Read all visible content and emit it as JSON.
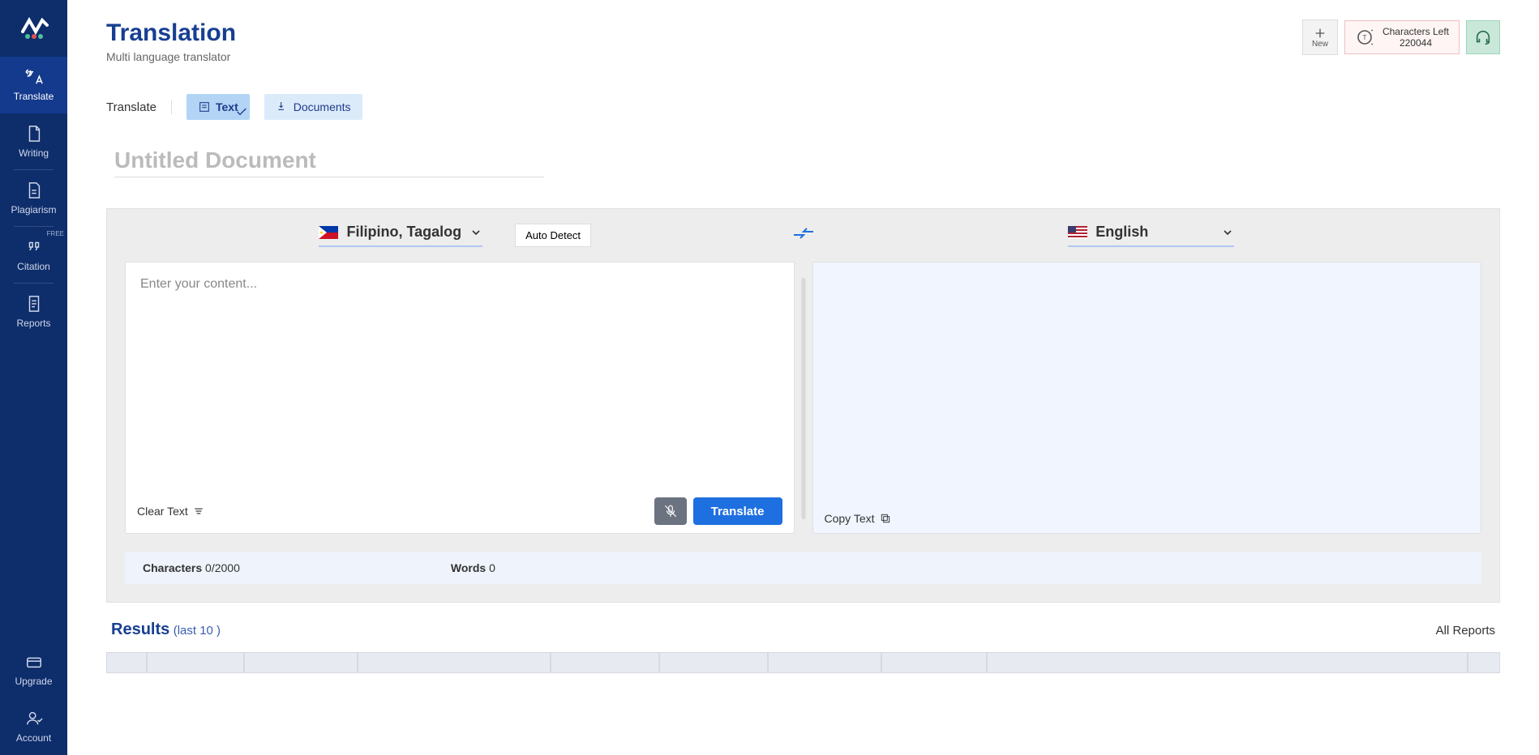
{
  "sidebar": {
    "items": [
      {
        "label": "Translate"
      },
      {
        "label": "Writing"
      },
      {
        "label": "Plagiarism"
      },
      {
        "label": "Citation",
        "badge": "FREE"
      },
      {
        "label": "Reports"
      },
      {
        "label": "Upgrade"
      },
      {
        "label": "Account"
      }
    ]
  },
  "header": {
    "title": "Translation",
    "subtitle": "Multi language translator",
    "new_label": "New",
    "chars_left_label": "Characters Left",
    "chars_left_value": "220044"
  },
  "tabs": {
    "label": "Translate",
    "text": "Text",
    "documents": "Documents"
  },
  "doc": {
    "title_placeholder": "Untitled Document"
  },
  "source": {
    "lang": "Filipino, Tagalog",
    "auto_detect": "Auto Detect",
    "placeholder": "Enter your content...",
    "clear": "Clear Text",
    "translate_btn": "Translate"
  },
  "target": {
    "lang": "English",
    "copy": "Copy Text"
  },
  "stats": {
    "chars_label": "Characters",
    "chars_value": "0/2000",
    "words_label": "Words",
    "words_value": "0"
  },
  "results": {
    "title": "Results",
    "sub": "(last 10 )",
    "all": "All Reports"
  }
}
